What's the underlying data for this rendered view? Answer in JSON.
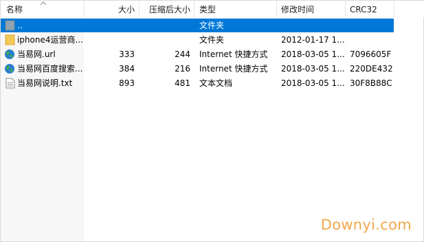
{
  "header": {
    "columns": [
      {
        "key": "name",
        "label": "名称"
      },
      {
        "key": "size",
        "label": "大小"
      },
      {
        "key": "packed",
        "label": "压缩后大小"
      },
      {
        "key": "type",
        "label": "类型"
      },
      {
        "key": "modified",
        "label": "修改时间"
      },
      {
        "key": "crc",
        "label": "CRC32"
      }
    ],
    "sort_icon": "sort-up-chevron"
  },
  "rows": [
    {
      "name": "..",
      "size": "",
      "packed": "",
      "type": "文件夹",
      "modified": "",
      "crc": "",
      "icon": "folder-up-icon",
      "selected": true
    },
    {
      "name": "iphone4运营商...",
      "size": "",
      "packed": "",
      "type": "文件夹",
      "modified": "2012-01-17 1...",
      "crc": "",
      "icon": "folder-icon",
      "selected": false
    },
    {
      "name": "当易网.url",
      "size": "333",
      "packed": "244",
      "type": "Internet 快捷方式",
      "modified": "2018-03-05 1...",
      "crc": "7096605F",
      "icon": "globe-icon",
      "selected": false
    },
    {
      "name": "当易网百度搜索...",
      "size": "384",
      "packed": "216",
      "type": "Internet 快捷方式",
      "modified": "2018-03-05 1...",
      "crc": "220DE432",
      "icon": "globe-icon",
      "selected": false
    },
    {
      "name": "当易网说明.txt",
      "size": "893",
      "packed": "481",
      "type": "文本文档",
      "modified": "2018-03-05 1...",
      "crc": "30F8B88C",
      "icon": "text-file-icon",
      "selected": false
    }
  ],
  "watermark": "Downyi.com",
  "colors": {
    "selection": "#0078d7",
    "watermark": "#f0a84a",
    "folder": "#f3c85a"
  }
}
